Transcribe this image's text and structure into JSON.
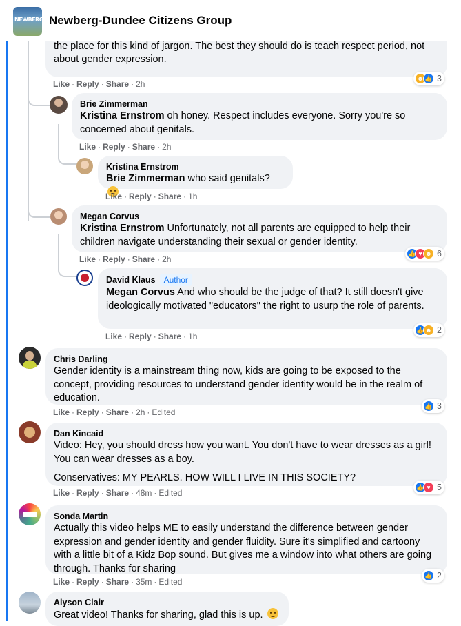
{
  "header": {
    "group_name": "Newberg-Dundee Citizens Group",
    "logo_text": "NEWBERG"
  },
  "action_labels": {
    "like": "Like",
    "reply": "Reply",
    "share": "Share"
  },
  "comments": [
    {
      "author": "",
      "text": "It not appropriate. It a parents job to teach their children that information. School is not the place for this kind of jargon. The best they should do is teach respect period, not about gender expression.",
      "time": "2h",
      "reactions": {
        "types": [
          "haha",
          "like"
        ],
        "count": "3"
      }
    },
    {
      "author": "Brie Zimmerman",
      "mention": "Kristina Ernstrom",
      "text": " oh honey. Respect includes everyone. Sorry you're so concerned about genitals.",
      "time": "2h"
    },
    {
      "author": "Kristina Ernstrom",
      "mention": "Brie Zimmerman",
      "text": " who said genitals?",
      "emoji": "frown",
      "time": "1h"
    },
    {
      "author": "Megan Corvus",
      "mention": "Kristina Ernstrom",
      "text": " Unfortunately, not all parents are equipped to help their children navigate understanding their sexual or gender identity.",
      "time": "2h",
      "reactions": {
        "types": [
          "like",
          "love",
          "haha"
        ],
        "count": "6"
      }
    },
    {
      "author": "David Klaus",
      "badge": "Author",
      "mention": "Megan Corvus",
      "text": " And who should be the judge of that? It still doesn't give ideologically motivated \"educators\" the right to usurp the role of parents.",
      "time": "1h",
      "reactions": {
        "types": [
          "like",
          "haha"
        ],
        "count": "2"
      }
    },
    {
      "author": "Chris Darling",
      "text": "Gender identity is a mainstream thing now, kids are going to be exposed to the concept, providing resources to understand gender identity would be in the realm of education.",
      "time": "2h",
      "edited": "Edited",
      "reactions": {
        "types": [
          "like"
        ],
        "count": "3"
      }
    },
    {
      "author": "Dan Kincaid",
      "text": "Video: Hey, you should dress how you want. You don't have to wear dresses as a girl! You can wear dresses as a boy.",
      "text2": "Conservatives: MY PEARLS. HOW WILL I LIVE IN THIS SOCIETY?",
      "time": "48m",
      "edited": "Edited",
      "reactions": {
        "types": [
          "like",
          "love"
        ],
        "count": "5"
      }
    },
    {
      "author": "Sonda Martin",
      "text": "Actually this video helps ME to easily understand the difference between gender expression and gender identity and gender fluidity. Sure it's simplified and cartoony with a little bit of a Kidz Bop sound. But gives me a window into what others are going through. Thanks for sharing",
      "time": "35m",
      "edited": "Edited",
      "reactions": {
        "types": [
          "like"
        ],
        "count": "2"
      }
    },
    {
      "author": "Alyson Clair",
      "text": "Great video! Thanks for sharing, glad this is up.",
      "emoji": "smile"
    }
  ],
  "colors": {
    "accent": "#1877f2",
    "bubble": "#f0f2f5",
    "meta": "#65676b"
  }
}
